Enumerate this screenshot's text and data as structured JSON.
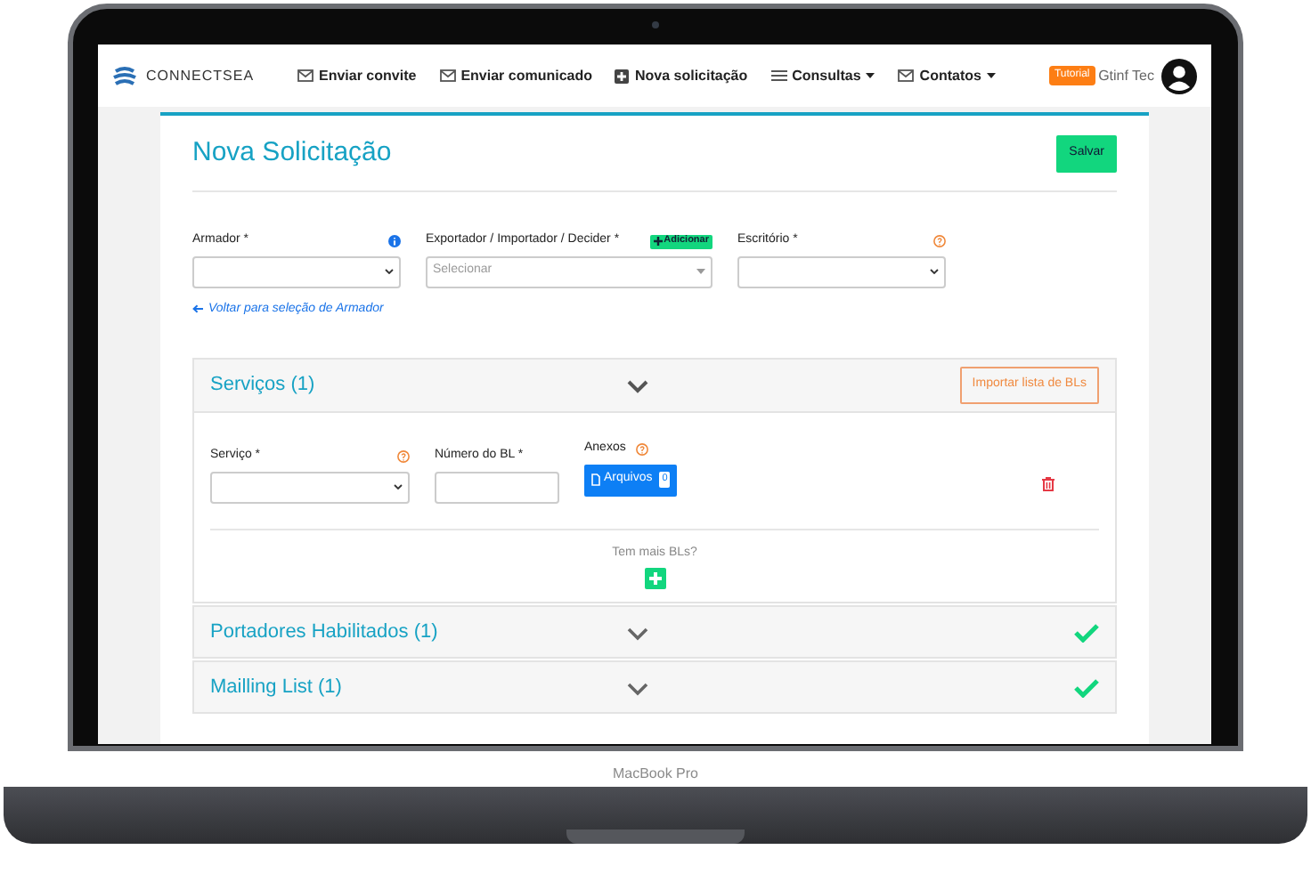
{
  "device": {
    "label": "MacBook Pro"
  },
  "navbar": {
    "brand": "CONNECTSEA",
    "items": [
      {
        "label": "Enviar convite",
        "kind": "envelope",
        "dropdown": false
      },
      {
        "label": "Enviar comunicado",
        "kind": "envelope",
        "dropdown": false
      },
      {
        "label": "Nova solicitação",
        "kind": "plus",
        "dropdown": false
      },
      {
        "label": "Consultas",
        "kind": "list",
        "dropdown": true
      },
      {
        "label": "Contatos",
        "kind": "envelope",
        "dropdown": true
      }
    ],
    "tutorial": "Tutorial",
    "user": "Gtinf Tec"
  },
  "form": {
    "title": "Nova Solicitação",
    "save": "Salvar",
    "fields": [
      {
        "label": "Armador *",
        "kind": "info"
      },
      {
        "label": "Exportador / Importador / Decider *",
        "kind": "add",
        "add_label": "Adicionar",
        "placeholder": "Selecionar"
      },
      {
        "label": "Escritório *",
        "kind": "help"
      }
    ],
    "back_link": "Voltar para seleção de Armador"
  },
  "sections": [
    {
      "title": "Serviços (1)",
      "expanded": true,
      "complete": false,
      "action": "Importar lista de BLs",
      "service": {
        "service_label": "Serviço *",
        "bl_label": "Número do BL *",
        "attachments_label": "Anexos",
        "files_button": "Arquivos",
        "files_count": "0",
        "more_prompt": "Tem mais BLs?"
      }
    },
    {
      "title": "Portadores Habilitados (1)",
      "expanded": false,
      "complete": true
    },
    {
      "title": "Mailling List (1)",
      "expanded": false,
      "complete": true
    }
  ]
}
